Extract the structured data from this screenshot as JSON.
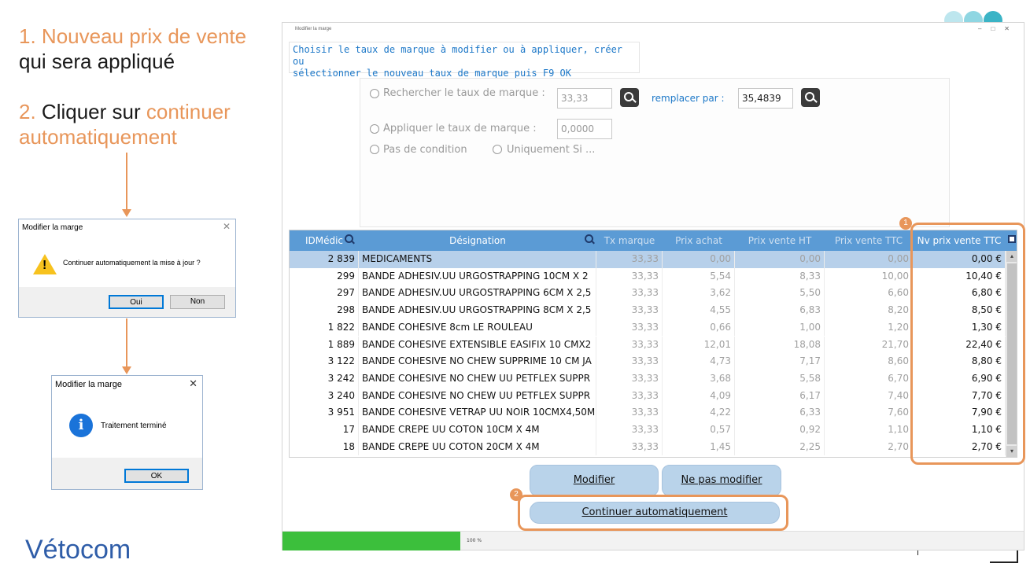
{
  "instructions": {
    "step1_number": "1.",
    "step1_highlight": "Nouveau prix de vente",
    "step1_rest": "qui sera appliqué",
    "step2_number": "2.",
    "step2_text": "Cliquer sur",
    "step2_highlight_1": "continuer",
    "step2_highlight_2": "automatiquement"
  },
  "confirm_dialog": {
    "title": "Modifier la marge",
    "message": "Continuer automatiquement la mise à jour ?",
    "yes_label": "Oui",
    "no_label": "Non"
  },
  "done_dialog": {
    "title": "Modifier la marge",
    "message": "Traitement terminé",
    "ok_label": "OK",
    "close_glyph": "✕"
  },
  "logo": {
    "text": "Vétocom"
  },
  "window": {
    "title": "Modifier la marge",
    "instruction_line1": "Choisir le taux de marque à modifier ou à appliquer, créer ou",
    "instruction_line2": "sélectionner le nouveau taux de marque puis F9 OK",
    "search_label": "Rechercher le taux de marque :",
    "search_value": "33,33",
    "replace_label": "remplacer par :",
    "replace_value": "35,4839",
    "apply_label": "Appliquer le taux de marque :",
    "apply_value": "0,0000",
    "no_condition_label": "Pas de condition",
    "only_if_label": "Uniquement Si ...",
    "progress_percent": 24,
    "progress_text": "100 %"
  },
  "table": {
    "columns": [
      "IDMédic",
      "Désignation",
      "Tx marque",
      "Prix achat",
      "Prix vente HT",
      "Prix vente TTC",
      "Nv prix vente TTC"
    ],
    "rows": [
      [
        "2 839",
        "MEDICAMENTS",
        "33,33",
        "0,00",
        "0,00",
        "0,00",
        "0,00 €"
      ],
      [
        "299",
        "BANDE ADHESIV.UU URGOSTRAPPING 10CM X 2",
        "33,33",
        "5,54",
        "8,33",
        "10,00",
        "10,40 €"
      ],
      [
        "297",
        "BANDE ADHESIV.UU URGOSTRAPPING 6CM X 2,5",
        "33,33",
        "3,62",
        "5,50",
        "6,60",
        "6,80 €"
      ],
      [
        "298",
        "BANDE ADHESIV.UU URGOSTRAPPING 8CM X 2,5",
        "33,33",
        "4,55",
        "6,83",
        "8,20",
        "8,50 €"
      ],
      [
        "1 822",
        "BANDE COHESIVE 8cm LE ROULEAU",
        "33,33",
        "0,66",
        "1,00",
        "1,20",
        "1,30 €"
      ],
      [
        "1 889",
        "BANDE COHESIVE EXTENSIBLE EASIFIX 10 CMX2",
        "33,33",
        "12,01",
        "18,08",
        "21,70",
        "22,40 €"
      ],
      [
        "3 122",
        "BANDE COHESIVE NO CHEW SUPPRIME 10 CM JA",
        "33,33",
        "4,73",
        "7,17",
        "8,60",
        "8,80 €"
      ],
      [
        "3 242",
        "BANDE COHESIVE NO CHEW UU PETFLEX SUPPR",
        "33,33",
        "3,68",
        "5,58",
        "6,70",
        "6,90 €"
      ],
      [
        "3 240",
        "BANDE COHESIVE NO CHEW UU PETFLEX SUPPR",
        "33,33",
        "4,09",
        "6,17",
        "7,40",
        "7,70 €"
      ],
      [
        "3 951",
        "BANDE COHESIVE VETRAP UU NOIR 10CMX4,50M",
        "33,33",
        "4,22",
        "6,33",
        "7,60",
        "7,90 €"
      ],
      [
        "17",
        "BANDE CREPE UU COTON 10CM X 4M",
        "33,33",
        "0,57",
        "0,92",
        "1,10",
        "1,10 €"
      ],
      [
        "18",
        "BANDE CREPE UU COTON 20CM X 4M",
        "33,33",
        "1,45",
        "2,25",
        "2,70",
        "2,70 €"
      ]
    ]
  },
  "actions": {
    "modify_label": "Modifier",
    "dont_modify_label": "Ne pas modifier",
    "continue_label": "Continuer automatiquement"
  },
  "badges": {
    "one": "1",
    "two": "2"
  },
  "colors": {
    "accent_orange": "#e8965a",
    "header_blue": "#5b9bd5",
    "selected_row": "#b7d0ea",
    "progress_green": "#3cbf3c",
    "link_blue": "#1d78c8"
  }
}
